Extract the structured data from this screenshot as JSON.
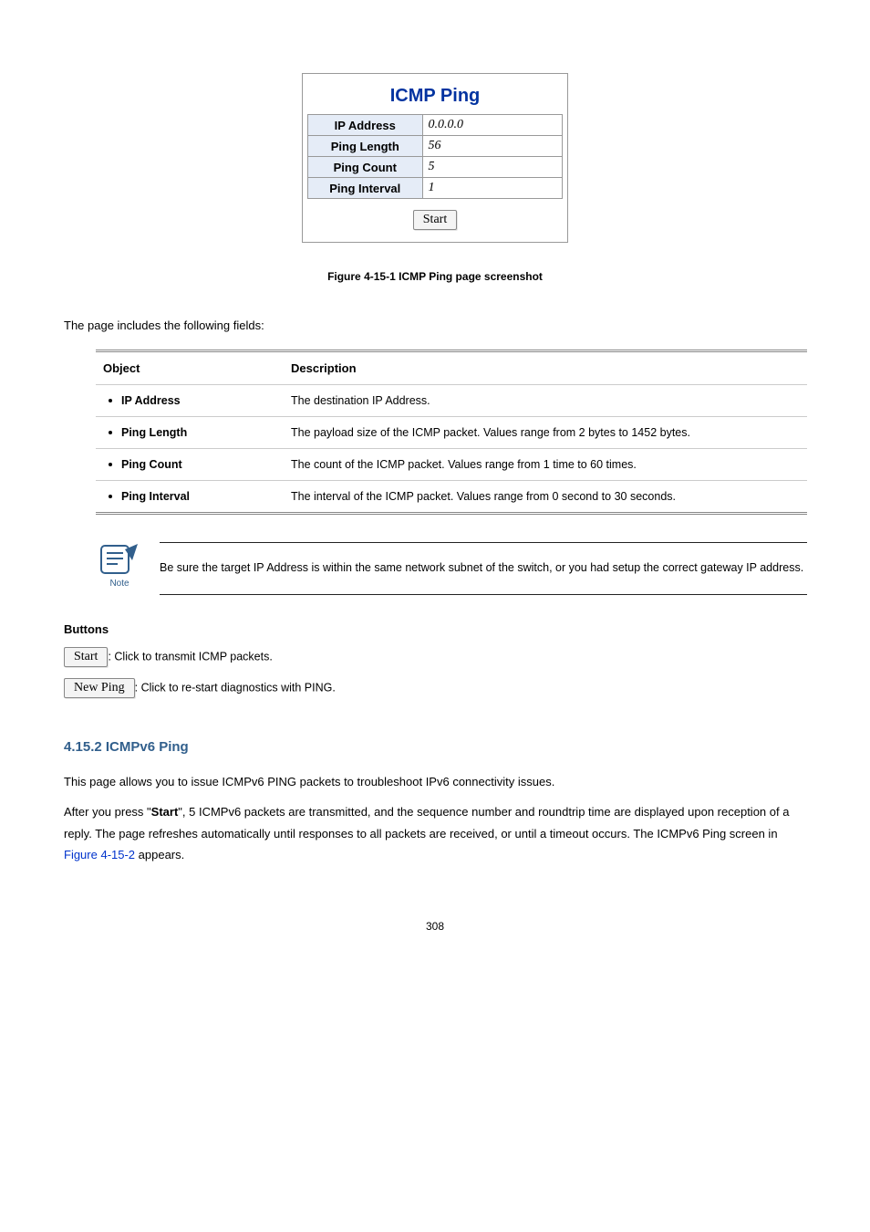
{
  "icmp_box": {
    "title": "ICMP Ping",
    "rows": [
      {
        "label": "IP Address",
        "value": "0.0.0.0"
      },
      {
        "label": "Ping Length",
        "value": "56"
      },
      {
        "label": "Ping Count",
        "value": "5"
      },
      {
        "label": "Ping Interval",
        "value": "1"
      }
    ],
    "start_btn": "Start"
  },
  "figure_caption": {
    "prefix": "Figure 4-15-1",
    "text": "ICMP Ping page screenshot"
  },
  "intro_line": "The page includes the following fields:",
  "table": {
    "head_object": "Object",
    "head_desc": "Description",
    "rows": [
      {
        "obj": "IP Address",
        "desc": "The destination IP Address."
      },
      {
        "obj": "Ping Length",
        "desc": "The payload size of the ICMP packet. Values range from 2 bytes to 1452 bytes."
      },
      {
        "obj": "Ping Count",
        "desc": "The count of the ICMP packet. Values range from 1 time to 60 times."
      },
      {
        "obj": "Ping Interval",
        "desc": "The interval of the ICMP packet. Values range from 0 second to 30 seconds."
      }
    ]
  },
  "note": {
    "label": "Note",
    "text": "Be sure the target IP Address is within the same network subnet of the switch, or you had setup the correct gateway IP address."
  },
  "buttons_title": "Buttons",
  "buttons": [
    {
      "btn": "Start",
      "desc": ": Click to transmit ICMP packets."
    },
    {
      "btn": "New Ping",
      "desc": ": Click to re-start diagnostics with PING."
    }
  ],
  "section_title": "4.15.2 ICMPv6 Ping",
  "para": {
    "l1": "This page allows you to issue ICMPv6 PING packets to troubleshoot IPv6 connectivity issues.",
    "l2a": "After you press \"",
    "l2b": "Start",
    "l2c": "\", 5 ICMPv6 packets are transmitted, and the sequence number and roundtrip time are displayed upon reception of a reply. The page refreshes automatically until responses to all packets are received, or until a timeout occurs. The ICMPv6 Ping screen in ",
    "l2link": "Figure 4-15-2",
    "l2d": " appears."
  },
  "pagenum": "308"
}
